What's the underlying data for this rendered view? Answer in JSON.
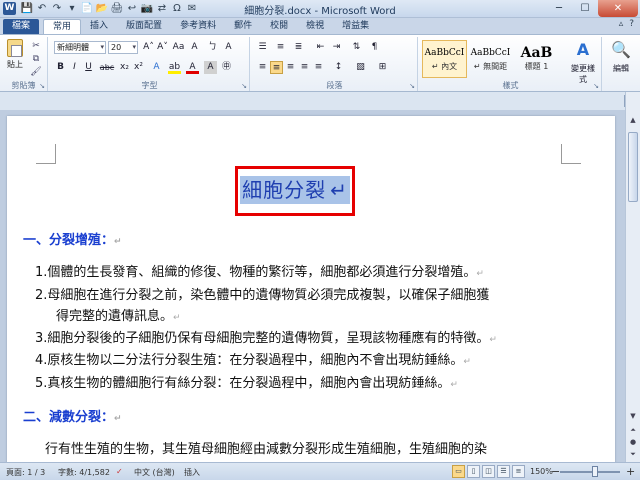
{
  "titlebar": {
    "title": "細胞分裂.docx - Microsoft Word",
    "app_icon": "W",
    "qat": [
      "💾",
      "↶",
      "↷",
      "▾"
    ],
    "extra_icons": [
      "📄",
      "📂",
      "🖨",
      "↩",
      "📷",
      "⇄",
      "Ω",
      "✉"
    ],
    "min": "─",
    "max": "☐",
    "close": "✕"
  },
  "tabs": {
    "file": "檔案",
    "items": [
      "常用",
      "插入",
      "版面配置",
      "參考資料",
      "郵件",
      "校閱",
      "檢視",
      "增益集"
    ],
    "right": [
      "▵",
      "?"
    ]
  },
  "ribbon": {
    "clipboard": {
      "label": "剪貼簿",
      "paste": "貼上",
      "cut": "✂",
      "copy": "⧉",
      "format_painter": "🖌"
    },
    "font": {
      "label": "字型",
      "name": "新細明體",
      "size": "20",
      "grow": "A˄",
      "shrink": "A˅",
      "case": "Aa",
      "clear": "A",
      "phonetic": "ㄅ",
      "enclose": "A",
      "bold": "B",
      "italic": "I",
      "underline": "U",
      "strike": "abc",
      "sub": "x₂",
      "sup": "x²",
      "effects": "A",
      "highlight": "ab",
      "color": "A",
      "shade": "A",
      "char_border": "A",
      "enc": "㊥"
    },
    "paragraph": {
      "label": "段落",
      "bullets": "☰",
      "numbering": "≡",
      "multilevel": "≣",
      "decrease": "⇤",
      "increase": "⇥",
      "sort": "⇅",
      "show": "¶",
      "align_left": "≡",
      "center": "≡",
      "align_right": "≡",
      "justify": "≡",
      "distributed": "≡",
      "spacing": "↕",
      "shading": "▧",
      "borders": "⊞"
    },
    "styles": {
      "label": "樣式",
      "items": [
        {
          "sample": "AaBbCcI",
          "name": "↵ 內文"
        },
        {
          "sample": "AaBbCcI",
          "name": "↵ 無間距"
        },
        {
          "sample": "AaB",
          "name": "標題 1"
        }
      ],
      "change": "變更樣式"
    },
    "editing": {
      "label": "編輯"
    }
  },
  "document": {
    "title": "細胞分裂",
    "heading1": "一、分裂增殖：",
    "items": [
      "1.個體的生長發育、組織的修復、物種的繁衍等，細胞都必須進行分裂增殖。",
      "2.母細胞在進行分裂之前，染色體中的遺傳物質必須完成複製，以確保子細胞獲",
      "得完整的遺傳訊息。",
      "3.細胞分裂後的子細胞仍保有母細胞完整的遺傳物質，呈現該物種應有的特徵。",
      "4.原核生物以二分法行分裂生殖：在分裂過程中，細胞內不會出現紡錘絲。",
      "5.真核生物的體細胞行有絲分裂：在分裂過程中，細胞內會出現紡錘絲。"
    ],
    "heading2": "二、減數分裂：",
    "last_line": "行有性生殖的生物，其生殖母細胞經由減數分裂形成生殖細胞，生殖細胞的染",
    "para_mark": "↵"
  },
  "statusbar": {
    "page": "頁面: 1 / 3",
    "words": "字數: 4/1,582",
    "lang": "中文 (台灣)",
    "mode": "插入",
    "zoom": "150%",
    "zoom_minus": "−",
    "zoom_plus": "+",
    "zoom_level": 0.58
  }
}
